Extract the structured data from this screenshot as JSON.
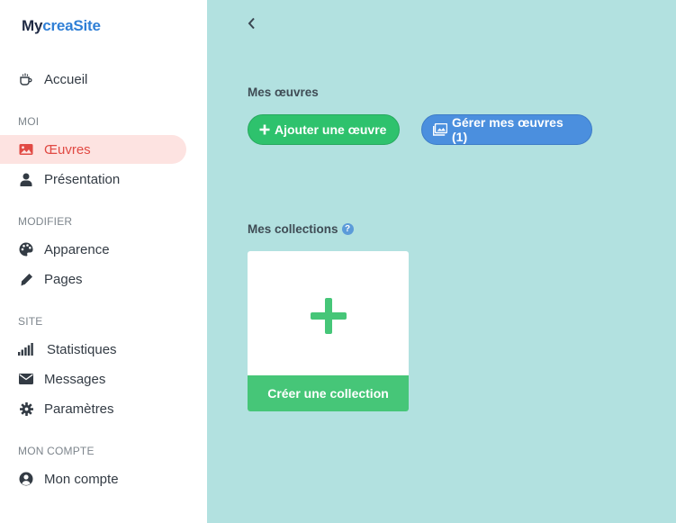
{
  "logo": {
    "part1": "My",
    "part2": "creaSite"
  },
  "nav": {
    "home": "Accueil",
    "sections": {
      "moi": "MOI",
      "modifier": "MODIFIER",
      "site": "SITE",
      "compte": "MON COMPTE"
    },
    "items": {
      "oeuvres": "Œuvres",
      "presentation": "Présentation",
      "apparence": "Apparence",
      "pages": "Pages",
      "statistiques": "Statistiques",
      "messages": "Messages",
      "parametres": "Paramètres",
      "mon_compte": "Mon compte"
    }
  },
  "main": {
    "works_heading": "Mes œuvres",
    "add_work_button": "Ajouter une œuvre",
    "manage_works_button": "Gérer mes œuvres (1)",
    "collections_heading": "Mes collections",
    "help_glyph": "?",
    "create_collection_label": "Créer une collection"
  },
  "colors": {
    "active_text": "#e14a44",
    "active_bg": "#fde3e1",
    "main_bg": "#b2e1e0",
    "green": "#2ec26d",
    "blue": "#4b8fde"
  },
  "icons": [
    "cup-icon",
    "image-icon",
    "user-icon",
    "palette-icon",
    "pencil-icon",
    "bar-chart-icon",
    "envelope-icon",
    "gear-icon",
    "user-circle-icon",
    "chevron-left-icon",
    "plus-icon",
    "images-icon",
    "help-icon"
  ]
}
